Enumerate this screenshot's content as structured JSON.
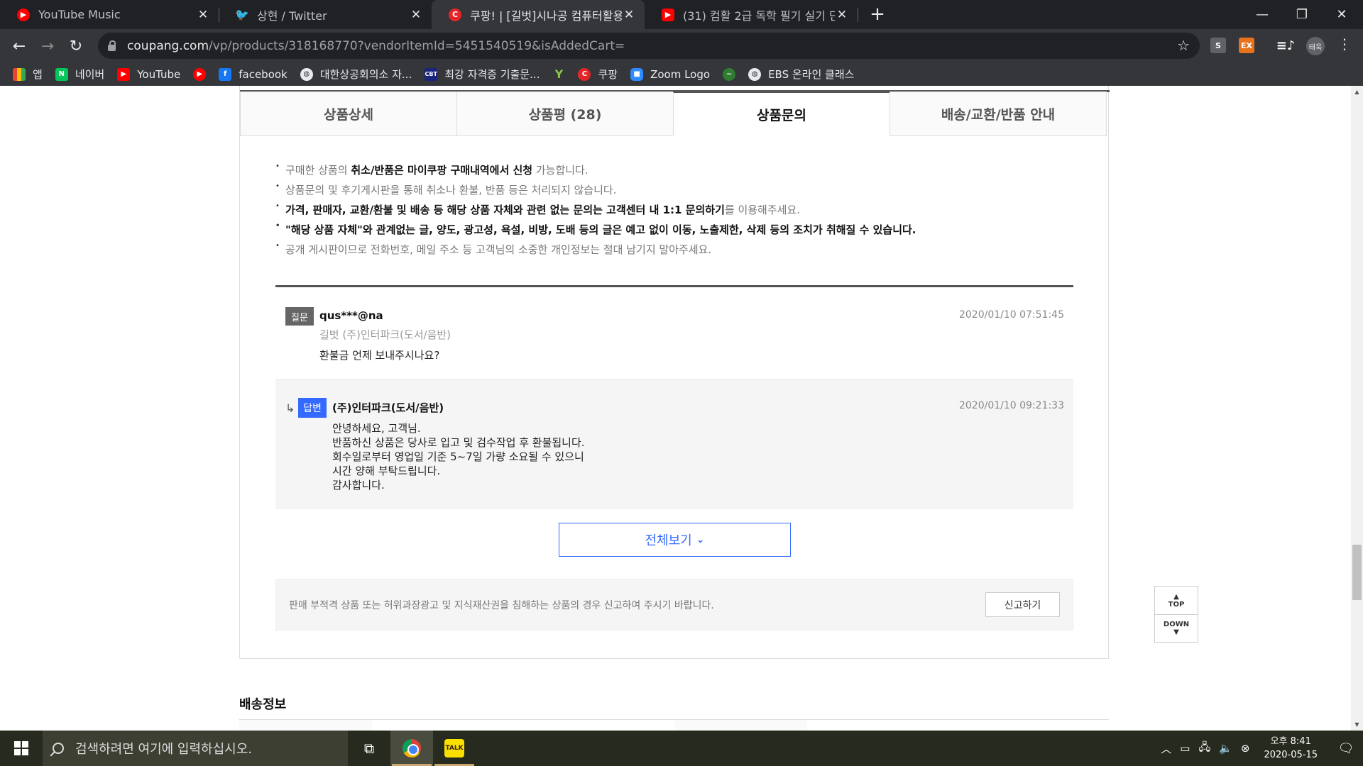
{
  "browser": {
    "tabs": [
      {
        "title": "YouTube Music",
        "icon": "youtube-music-icon",
        "color": "#ff0000"
      },
      {
        "title": "상현 / Twitter",
        "icon": "twitter-icon",
        "color": "#1da1f2"
      },
      {
        "title": "쿠팡! | [길벗]시나공 컴퓨터활용",
        "icon": "coupang-icon",
        "color": "#e52528"
      },
      {
        "title": "(31) 컴활 2급 독학 필기 실기 단",
        "icon": "youtube-icon",
        "color": "#ff0000"
      }
    ],
    "url_host": "coupang.com",
    "url_path": "/vp/products/318168770?vendorItemId=5451540519&isAddedCart=",
    "avatar_text": "태욱",
    "extensions": [
      "S",
      "EX"
    ]
  },
  "bookmarks": [
    {
      "label": "앱",
      "icon": "apps-grid-icon"
    },
    {
      "label": "네이버",
      "icon": "naver-icon"
    },
    {
      "label": "YouTube",
      "icon": "youtube-icon"
    },
    {
      "label": "",
      "icon": "youtube-music-icon"
    },
    {
      "label": "facebook",
      "icon": "facebook-icon"
    },
    {
      "label": "대한상공회의소 자...",
      "icon": "globe-icon"
    },
    {
      "label": "최강 자격증 기출문...",
      "icon": "cbt-icon"
    },
    {
      "label": "",
      "icon": "y-icon"
    },
    {
      "label": "쿠팡",
      "icon": "coupang-icon"
    },
    {
      "label": "Zoom Logo",
      "icon": "zoom-icon"
    },
    {
      "label": "",
      "icon": "green-circle-icon"
    },
    {
      "label": "EBS 온라인 클래스",
      "icon": "globe-icon"
    }
  ],
  "product_tabs": [
    "상품상세",
    "상품평 (28)",
    "상품문의",
    "배송/교환/반품 안내"
  ],
  "active_tab": "상품문의",
  "notices": {
    "n1_pre": "구매한 상품의 ",
    "n1_bold": "취소/반품은 마이쿠팡 구매내역에서 신청",
    "n1_post": " 가능합니다.",
    "n2": "상품문의 및 후기게시판을 통해 취소나 환불, 반품 등은 처리되지 않습니다.",
    "n3_bold": "가격, 판매자, 교환/환불 및 배송 등 해당 상품 자체와 관련 없는 문의는 고객센터 내 1:1 문의하기",
    "n3_post": "를 이용해주세요.",
    "n4": "\"해당 상품 자체\"와 관계없는 글, 양도, 광고성, 욕설, 비방, 도배 등의 글은 예고 없이 이동, 노출제한, 삭제 등의 조치가 취해질 수 있습니다.",
    "n5": "공개 게시판이므로 전화번호, 메일 주소 등 고객님의 소중한 개인정보는 절대 남기지 말아주세요."
  },
  "question": {
    "badge": "질문",
    "writer": "qus***@na",
    "date": "2020/01/10 07:51:45",
    "seller_line": "길벗  (주)인터파크(도서/음반)",
    "text": "환불금 언제 보내주시나요?"
  },
  "answer": {
    "badge": "답변",
    "arrow": "↳",
    "seller": "(주)인터파크(도서/음반)",
    "date": "2020/01/10 09:21:33",
    "lines": [
      "안녕하세요, 고객님.",
      "반품하신 상품은 당사로 입고 및 검수작업 후 환불됩니다.",
      "회수일로부터 영업일 기준 5~7일 가량 소요될 수 있으니",
      "시간 양해 부탁드립니다.",
      "감사합니다."
    ]
  },
  "view_all_label": "전체보기",
  "report": {
    "text": "판매 부적격 상품 또는 허위과장광고 및 지식재산권을 침해하는 상품의 경우 신고하여 주시기 바랍니다.",
    "button": "신고하기"
  },
  "delivery_title": "배송정보",
  "floating": {
    "top": "TOP",
    "down": "DOWN"
  },
  "taskbar": {
    "search_placeholder": "검색하려면 여기에 입력하십시오.",
    "time": "오후 8:41",
    "date": "2020-05-15"
  },
  "colors": {
    "accent": "#346aff",
    "taskbar": "#272a1e",
    "chrome_dark": "#202124"
  }
}
